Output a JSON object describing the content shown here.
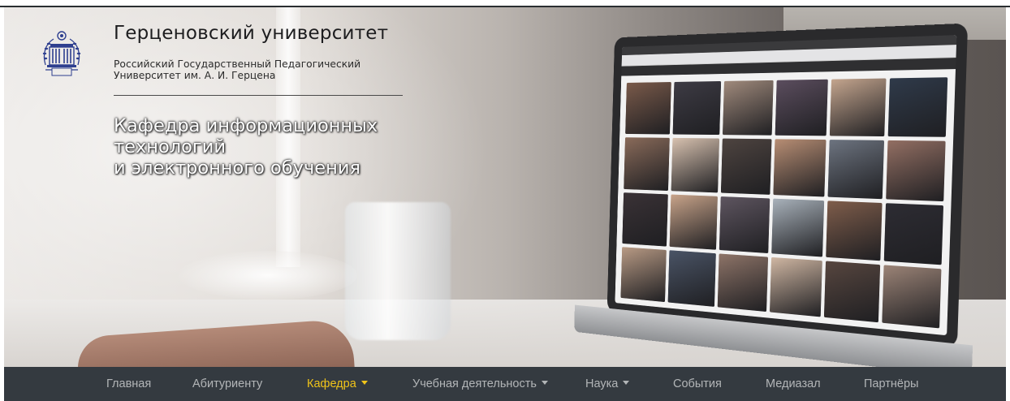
{
  "brand": {
    "title": "Герценовский университет",
    "subtitle_line1": "Российский Государственный Педагогический",
    "subtitle_line2": "Университет им. А. И. Герцена",
    "logo_icon": "university-emblem-icon"
  },
  "department": {
    "line1": "Кафедра информационных",
    "line2": "технологий",
    "line3": "и электронного обучения"
  },
  "hero": {
    "image_icon": "laptop-photo-gallery-image"
  },
  "nav": {
    "items": [
      {
        "label": "Главная",
        "dropdown": false,
        "active": false
      },
      {
        "label": "Абитуриенту",
        "dropdown": false,
        "active": false
      },
      {
        "label": "Кафедра",
        "dropdown": true,
        "active": true
      },
      {
        "label": "Учебная деятельность",
        "dropdown": true,
        "active": false
      },
      {
        "label": "Наука",
        "dropdown": true,
        "active": false
      },
      {
        "label": "События",
        "dropdown": false,
        "active": false
      },
      {
        "label": "Медиазал",
        "dropdown": false,
        "active": false
      },
      {
        "label": "Партнёры",
        "dropdown": false,
        "active": false
      }
    ]
  },
  "colors": {
    "navbar_bg": "#343a40",
    "nav_text": "#b9bcbf",
    "nav_active": "#f0c419",
    "logo_blue": "#2e3f8f"
  }
}
